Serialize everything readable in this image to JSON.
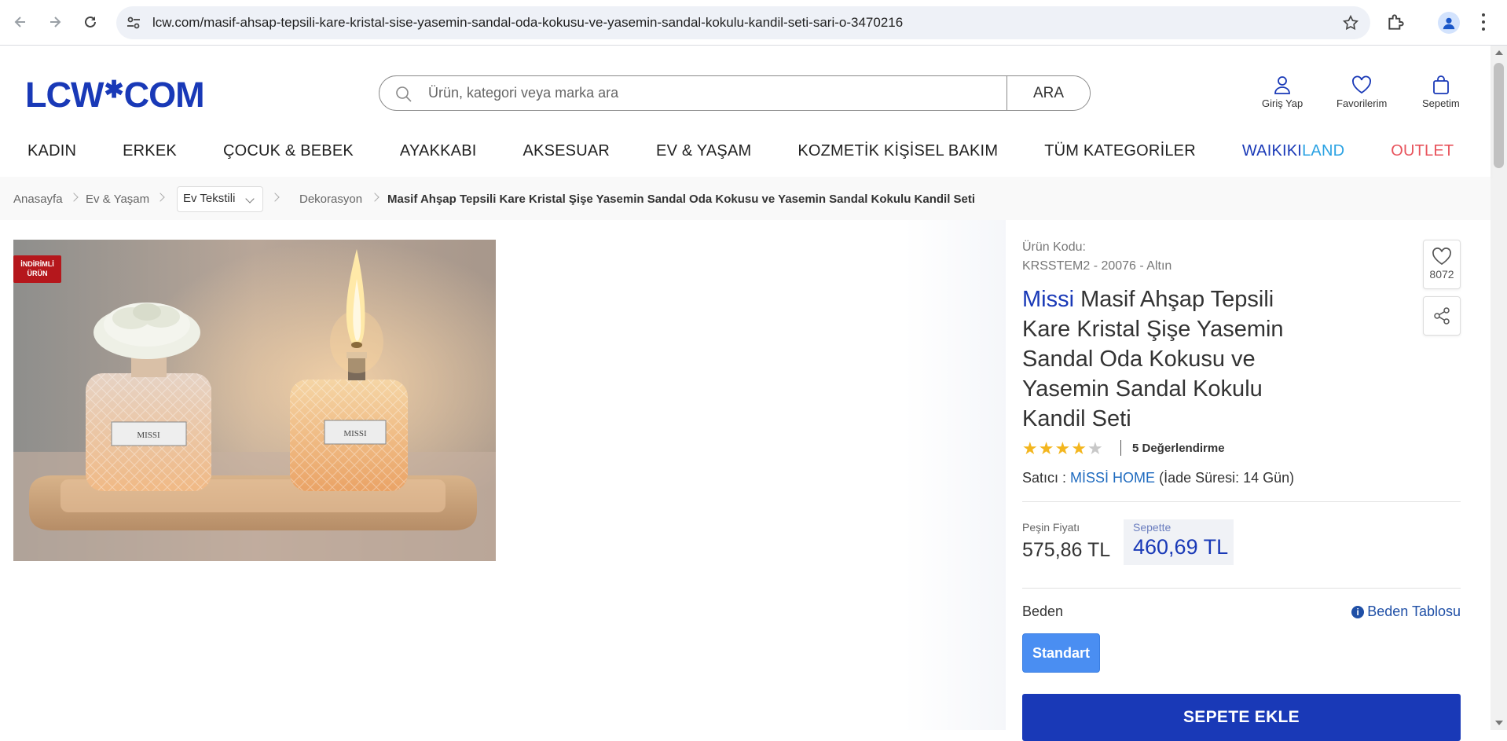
{
  "browser": {
    "url": "lcw.com/masif-ahsap-tepsili-kare-kristal-sise-yasemin-sandal-oda-kokusu-ve-yasemin-sandal-kokulu-kandil-seti-sari-o-3470216"
  },
  "header": {
    "logo_left": "LCW",
    "logo_star": "✱",
    "logo_right": "COM",
    "search_placeholder": "Ürün, kategori veya marka ara",
    "search_button": "ARA",
    "login_label": "Giriş Yap",
    "favorites_label": "Favorilerim",
    "cart_label": "Sepetim"
  },
  "nav": {
    "items": [
      "KADIN",
      "ERKEK",
      "ÇOCUK & BEBEK",
      "AYAKKABI",
      "AKSESUAR",
      "EV & YAŞAM",
      "KOZMETİK KİŞİSEL BAKIM",
      "TÜM KATEGORİLER"
    ],
    "waikiki_a": "WAIKIKI",
    "waikiki_b": "LAND",
    "outlet": "OUTLET"
  },
  "breadcrumb": {
    "home": "Anasayfa",
    "level1": "Ev & Yaşam",
    "dropdown": "Ev Tekstili",
    "level3": "Dekorasyon",
    "current": "Masif Ahşap Tepsili Kare Kristal Şişe Yasemin Sandal Oda Kokusu ve Yasemin Sandal Kokulu Kandil Seti"
  },
  "product": {
    "badge_line1": "İNDİRİMLİ",
    "badge_line2": "ÜRÜN",
    "bottle_label": "MISSI",
    "code_label": "Ürün Kodu:",
    "code_value": "KRSSTEM2 - 20076 - Altın",
    "brand": "Missi",
    "name": "Masif Ahşap Tepsili Kare Kristal Şişe Yasemin Sandal Oda Kokusu ve Yasemin Sandal Kokulu Kandil Seti",
    "rating_stars": 4,
    "rating_text": "5 Değerlendirme",
    "seller_prefix": "Satıcı :",
    "seller_name": "MİSSİ HOME",
    "return_info": "(İade Süresi: 14 Gün)",
    "price_label": "Peşin Fiyatı",
    "price": "575,86 TL",
    "basket_label": "Sepette",
    "basket_price": "460,69 TL",
    "size_label": "Beden",
    "size_table": "Beden Tablosu",
    "size_option": "Standart",
    "add_to_cart": "SEPETE EKLE",
    "favorite_count": "8072"
  },
  "colors": {
    "brand_blue": "#1939b7",
    "outlet_red": "#e8535c",
    "star_yellow": "#f3b61f",
    "size_button": "#4a8ef2"
  }
}
